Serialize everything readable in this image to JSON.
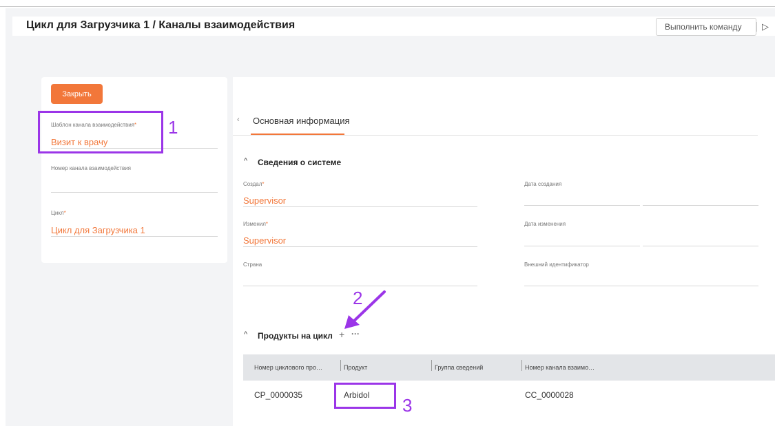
{
  "header": {
    "title": "Цикл для Загрузчика 1 / Каналы взаимодействия",
    "command_button": "Выполнить команду",
    "run_icon": "play-icon"
  },
  "left_card": {
    "close_button": "Закрыть",
    "fields": [
      {
        "label": "Шаблон канала взаимодействия",
        "required": true,
        "value": "Визит к врачу"
      },
      {
        "label": "Номер канала взаимодействия",
        "required": false,
        "value": ""
      },
      {
        "label": "Цикл",
        "required": true,
        "value": "Цикл для Загрузчика 1"
      }
    ]
  },
  "tabs": {
    "active": "Основная информация",
    "chevron_icon": "chevron-left-icon"
  },
  "system_section": {
    "title": "Сведения о системе",
    "fields": [
      {
        "label": "Создал",
        "required": true,
        "value": "Supervisor"
      },
      {
        "label": "Дата создания",
        "required": false,
        "value": ""
      },
      {
        "label": "Изменил",
        "required": true,
        "value": "Supervisor"
      },
      {
        "label": "Дата изменения",
        "required": false,
        "value": ""
      },
      {
        "label": "Страна",
        "required": false,
        "value": ""
      },
      {
        "label": "Внешний идентификатор",
        "required": false,
        "value": ""
      }
    ]
  },
  "products_section": {
    "title": "Продукты на цикл",
    "add_symbol": "+",
    "more_symbol": "···",
    "columns": [
      "Номер циклового про…",
      "Продукт",
      "Группа сведений",
      "Номер канала взаимо…"
    ],
    "rows": [
      {
        "number": "CP_0000035",
        "product": "Arbidol",
        "group": "",
        "channel": "CC_0000028"
      }
    ]
  },
  "annotations": [
    "1",
    "2",
    "3"
  ],
  "colors": {
    "accent": "#f2773a",
    "annotation": "#9b35e8",
    "background": "#f3f4f6"
  }
}
